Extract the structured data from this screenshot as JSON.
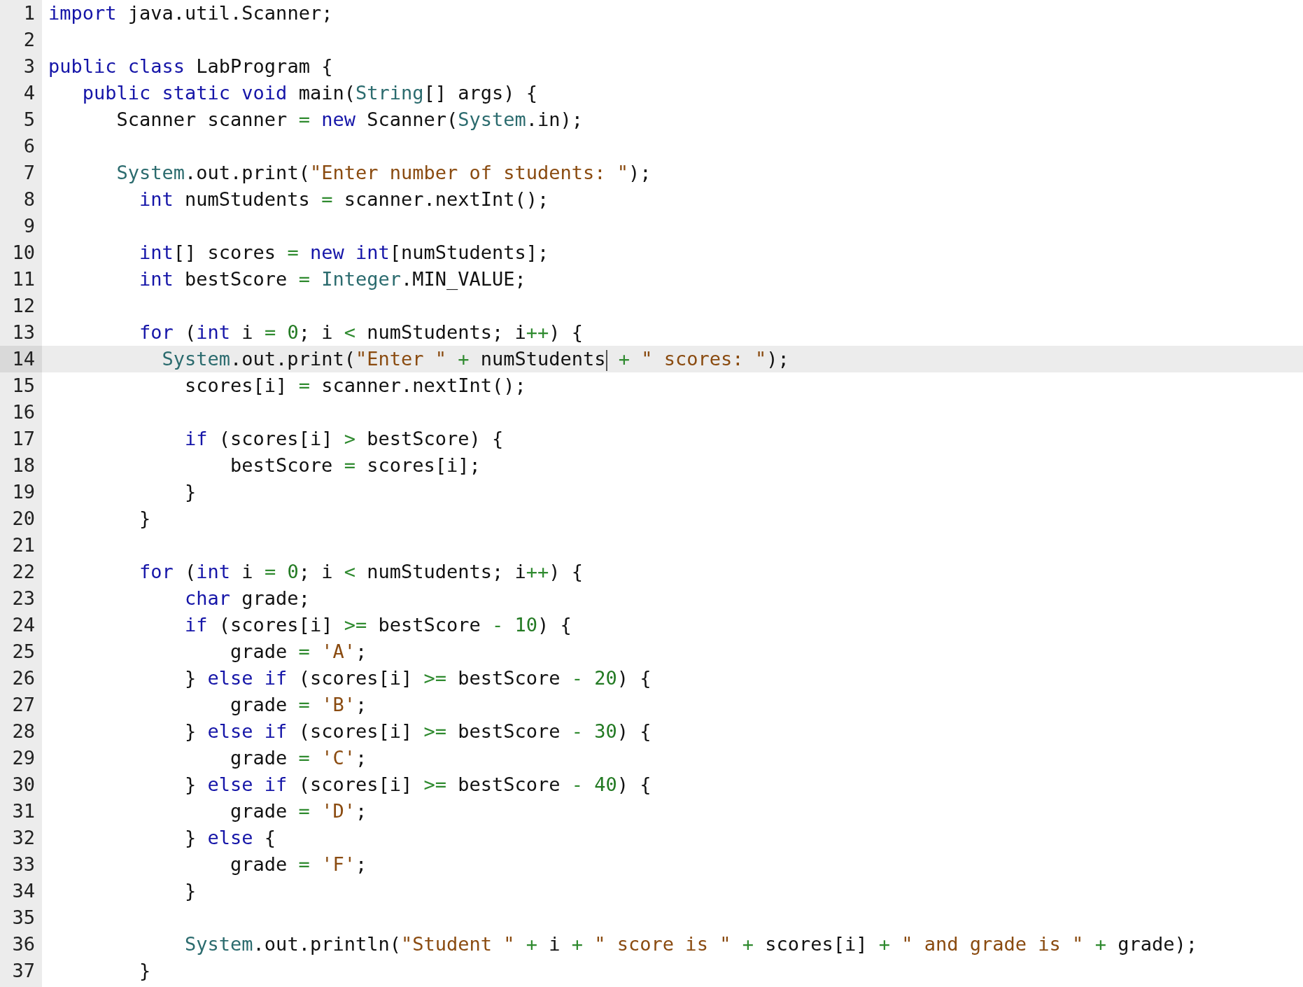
{
  "editor": {
    "lines": [
      {
        "number": "1",
        "current": false,
        "kind": "top_level",
        "tokens": [
          {
            "kind": "kw",
            "text": "import"
          },
          {
            "kind": "plain",
            "text": " java.util.Scanner;"
          }
        ]
      },
      {
        "number": "2",
        "current": false
      },
      {
        "number": "3",
        "current": false,
        "kind": "top_level",
        "tokens": [
          {
            "kind": "kw",
            "text": "public class"
          },
          {
            "kind": "plain",
            "text": " LabProgram {"
          }
        ]
      },
      {
        "number": "4",
        "current": false,
        "kind": "class_member",
        "tokens": [
          {
            "kind": "kw",
            "text": "public static void"
          },
          {
            "kind": "plain",
            "text": " main("
          },
          {
            "kind": "type",
            "text": "String"
          },
          {
            "kind": "plain",
            "text": "[] args) {"
          }
        ]
      },
      {
        "number": "5",
        "current": false,
        "kind": "method_body",
        "tokens": [
          {
            "kind": "plain",
            "text": "Scanner scanner"
          },
          {
            "kind": "op",
            "text": " = "
          },
          {
            "kind": "kw",
            "text": "new"
          },
          {
            "kind": "plain",
            "text": " Scanner("
          },
          {
            "kind": "type",
            "text": "System"
          },
          {
            "kind": "plain",
            "text": ".in);"
          }
        ]
      },
      {
        "number": "6",
        "current": false
      },
      {
        "number": "7",
        "current": false,
        "kind": "method_body",
        "tokens": [
          {
            "kind": "type",
            "text": "System"
          },
          {
            "kind": "plain",
            "text": ".out.print("
          },
          {
            "kind": "str",
            "text": "\"Enter number of students: \""
          },
          {
            "kind": "plain",
            "text": ");"
          }
        ]
      },
      {
        "number": "8",
        "current": false,
        "kind": "statement",
        "tokens": [
          {
            "kind": "kw",
            "text": "int"
          },
          {
            "kind": "plain",
            "text": " numStudents"
          },
          {
            "kind": "op",
            "text": " = "
          },
          {
            "kind": "plain",
            "text": "scanner.nextInt();"
          }
        ]
      },
      {
        "number": "9",
        "current": false
      },
      {
        "number": "10",
        "current": false,
        "kind": "statement",
        "tokens": [
          {
            "kind": "kw",
            "text": "int"
          },
          {
            "kind": "plain",
            "text": "[] scores"
          },
          {
            "kind": "op",
            "text": " = "
          },
          {
            "kind": "kw",
            "text": "new int"
          },
          {
            "kind": "plain",
            "text": "[numStudents];"
          }
        ]
      },
      {
        "number": "11",
        "current": false,
        "kind": "statement",
        "tokens": [
          {
            "kind": "kw",
            "text": "int"
          },
          {
            "kind": "plain",
            "text": " bestScore"
          },
          {
            "kind": "op",
            "text": " = "
          },
          {
            "kind": "type",
            "text": "Integer"
          },
          {
            "kind": "plain",
            "text": ".MIN_VALUE;"
          }
        ]
      },
      {
        "number": "12",
        "current": false
      },
      {
        "number": "13",
        "current": false,
        "kind": "statement",
        "tokens": [
          {
            "kind": "kw",
            "text": "for"
          },
          {
            "kind": "plain",
            "text": " ("
          },
          {
            "kind": "kw",
            "text": "int"
          },
          {
            "kind": "plain",
            "text": " i"
          },
          {
            "kind": "op",
            "text": " = "
          },
          {
            "kind": "num",
            "text": "0"
          },
          {
            "kind": "plain",
            "text": "; i"
          },
          {
            "kind": "op",
            "text": " < "
          },
          {
            "kind": "plain",
            "text": "numStudents; i"
          },
          {
            "kind": "op",
            "text": "++"
          },
          {
            "kind": "plain",
            "text": ") {"
          }
        ]
      },
      {
        "number": "14",
        "current": true,
        "kind": "loop_first",
        "tokens": [
          {
            "kind": "type",
            "text": "System"
          },
          {
            "kind": "plain",
            "text": ".out.print("
          },
          {
            "kind": "str",
            "text": "\"Enter \""
          },
          {
            "kind": "op",
            "text": " + "
          },
          {
            "kind": "plain",
            "text": "numStudents"
          },
          {
            "kind": "cursor"
          },
          {
            "kind": "op",
            "text": " + "
          },
          {
            "kind": "str",
            "text": "\" scores: \""
          },
          {
            "kind": "plain",
            "text": ");"
          }
        ]
      },
      {
        "number": "15",
        "current": false,
        "kind": "loop_body",
        "tokens": [
          {
            "kind": "plain",
            "text": "scores[i]"
          },
          {
            "kind": "op",
            "text": " = "
          },
          {
            "kind": "plain",
            "text": "scanner.nextInt();"
          }
        ]
      },
      {
        "number": "16",
        "current": false
      },
      {
        "number": "17",
        "current": false,
        "kind": "loop_body",
        "tokens": [
          {
            "kind": "kw",
            "text": "if"
          },
          {
            "kind": "plain",
            "text": " (scores[i]"
          },
          {
            "kind": "op",
            "text": " > "
          },
          {
            "kind": "plain",
            "text": "bestScore) {"
          }
        ]
      },
      {
        "number": "18",
        "current": false,
        "kind": "nested_body",
        "tokens": [
          {
            "kind": "plain",
            "text": "bestScore"
          },
          {
            "kind": "op",
            "text": " = "
          },
          {
            "kind": "plain",
            "text": "scores[i];"
          }
        ]
      },
      {
        "number": "19",
        "current": false,
        "kind": "loop_body",
        "tokens": [
          {
            "kind": "plain",
            "text": "}"
          }
        ]
      },
      {
        "number": "20",
        "current": false,
        "kind": "statement",
        "tokens": [
          {
            "kind": "plain",
            "text": "}"
          }
        ]
      },
      {
        "number": "21",
        "current": false
      },
      {
        "number": "22",
        "current": false,
        "kind": "statement",
        "tokens": [
          {
            "kind": "kw",
            "text": "for"
          },
          {
            "kind": "plain",
            "text": " ("
          },
          {
            "kind": "kw",
            "text": "int"
          },
          {
            "kind": "plain",
            "text": " i"
          },
          {
            "kind": "op",
            "text": " = "
          },
          {
            "kind": "num",
            "text": "0"
          },
          {
            "kind": "plain",
            "text": "; i"
          },
          {
            "kind": "op",
            "text": " < "
          },
          {
            "kind": "plain",
            "text": "numStudents; i"
          },
          {
            "kind": "op",
            "text": "++"
          },
          {
            "kind": "plain",
            "text": ") {"
          }
        ]
      },
      {
        "number": "23",
        "current": false,
        "kind": "loop_body",
        "tokens": [
          {
            "kind": "kw",
            "text": "char"
          },
          {
            "kind": "plain",
            "text": " grade;"
          }
        ]
      },
      {
        "number": "24",
        "current": false,
        "kind": "loop_body",
        "tokens": [
          {
            "kind": "kw",
            "text": "if"
          },
          {
            "kind": "plain",
            "text": " (scores[i]"
          },
          {
            "kind": "op",
            "text": " >= "
          },
          {
            "kind": "plain",
            "text": "bestScore"
          },
          {
            "kind": "op",
            "text": " - "
          },
          {
            "kind": "num",
            "text": "10"
          },
          {
            "kind": "plain",
            "text": ") {"
          }
        ]
      },
      {
        "number": "25",
        "current": false,
        "kind": "nested_body",
        "tokens": [
          {
            "kind": "plain",
            "text": "grade"
          },
          {
            "kind": "op",
            "text": " = "
          },
          {
            "kind": "str",
            "text": "'A'"
          },
          {
            "kind": "plain",
            "text": ";"
          }
        ]
      },
      {
        "number": "26",
        "current": false,
        "kind": "loop_body",
        "tokens": [
          {
            "kind": "plain",
            "text": "} "
          },
          {
            "kind": "kw",
            "text": "else if"
          },
          {
            "kind": "plain",
            "text": " (scores[i]"
          },
          {
            "kind": "op",
            "text": " >= "
          },
          {
            "kind": "plain",
            "text": "bestScore"
          },
          {
            "kind": "op",
            "text": " - "
          },
          {
            "kind": "num",
            "text": "20"
          },
          {
            "kind": "plain",
            "text": ") {"
          }
        ]
      },
      {
        "number": "27",
        "current": false,
        "kind": "nested_body",
        "tokens": [
          {
            "kind": "plain",
            "text": "grade"
          },
          {
            "kind": "op",
            "text": " = "
          },
          {
            "kind": "str",
            "text": "'B'"
          },
          {
            "kind": "plain",
            "text": ";"
          }
        ]
      },
      {
        "number": "28",
        "current": false,
        "kind": "loop_body",
        "tokens": [
          {
            "kind": "plain",
            "text": "} "
          },
          {
            "kind": "kw",
            "text": "else if"
          },
          {
            "kind": "plain",
            "text": " (scores[i]"
          },
          {
            "kind": "op",
            "text": " >= "
          },
          {
            "kind": "plain",
            "text": "bestScore"
          },
          {
            "kind": "op",
            "text": " - "
          },
          {
            "kind": "num",
            "text": "30"
          },
          {
            "kind": "plain",
            "text": ") {"
          }
        ]
      },
      {
        "number": "29",
        "current": false,
        "kind": "nested_body",
        "tokens": [
          {
            "kind": "plain",
            "text": "grade"
          },
          {
            "kind": "op",
            "text": " = "
          },
          {
            "kind": "str",
            "text": "'C'"
          },
          {
            "kind": "plain",
            "text": ";"
          }
        ]
      },
      {
        "number": "30",
        "current": false,
        "kind": "loop_body",
        "tokens": [
          {
            "kind": "plain",
            "text": "} "
          },
          {
            "kind": "kw",
            "text": "else if"
          },
          {
            "kind": "plain",
            "text": " (scores[i]"
          },
          {
            "kind": "op",
            "text": " >= "
          },
          {
            "kind": "plain",
            "text": "bestScore"
          },
          {
            "kind": "op",
            "text": " - "
          },
          {
            "kind": "num",
            "text": "40"
          },
          {
            "kind": "plain",
            "text": ") {"
          }
        ]
      },
      {
        "number": "31",
        "current": false,
        "kind": "nested_body",
        "tokens": [
          {
            "kind": "plain",
            "text": "grade"
          },
          {
            "kind": "op",
            "text": " = "
          },
          {
            "kind": "str",
            "text": "'D'"
          },
          {
            "kind": "plain",
            "text": ";"
          }
        ]
      },
      {
        "number": "32",
        "current": false,
        "kind": "loop_body",
        "tokens": [
          {
            "kind": "plain",
            "text": "} "
          },
          {
            "kind": "kw",
            "text": "else"
          },
          {
            "kind": "plain",
            "text": " {"
          }
        ]
      },
      {
        "number": "33",
        "current": false,
        "kind": "nested_body",
        "tokens": [
          {
            "kind": "plain",
            "text": "grade"
          },
          {
            "kind": "op",
            "text": " = "
          },
          {
            "kind": "str",
            "text": "'F'"
          },
          {
            "kind": "plain",
            "text": ";"
          }
        ]
      },
      {
        "number": "34",
        "current": false,
        "kind": "loop_body",
        "tokens": [
          {
            "kind": "plain",
            "text": "}"
          }
        ]
      },
      {
        "number": "35",
        "current": false
      },
      {
        "number": "36",
        "current": false,
        "kind": "loop_body",
        "tokens": [
          {
            "kind": "type",
            "text": "System"
          },
          {
            "kind": "plain",
            "text": ".out.println("
          },
          {
            "kind": "str",
            "text": "\"Student \""
          },
          {
            "kind": "op",
            "text": " + "
          },
          {
            "kind": "plain",
            "text": "i"
          },
          {
            "kind": "op",
            "text": " + "
          },
          {
            "kind": "str",
            "text": "\" score is \""
          },
          {
            "kind": "op",
            "text": " + "
          },
          {
            "kind": "plain",
            "text": "scores[i]"
          },
          {
            "kind": "op",
            "text": " + "
          },
          {
            "kind": "str",
            "text": "\" and grade is \""
          },
          {
            "kind": "op",
            "text": " + "
          },
          {
            "kind": "plain",
            "text": "grade);"
          }
        ]
      },
      {
        "number": "37",
        "current": false,
        "kind": "statement",
        "tokens": [
          {
            "kind": "plain",
            "text": "}"
          }
        ]
      }
    ]
  }
}
